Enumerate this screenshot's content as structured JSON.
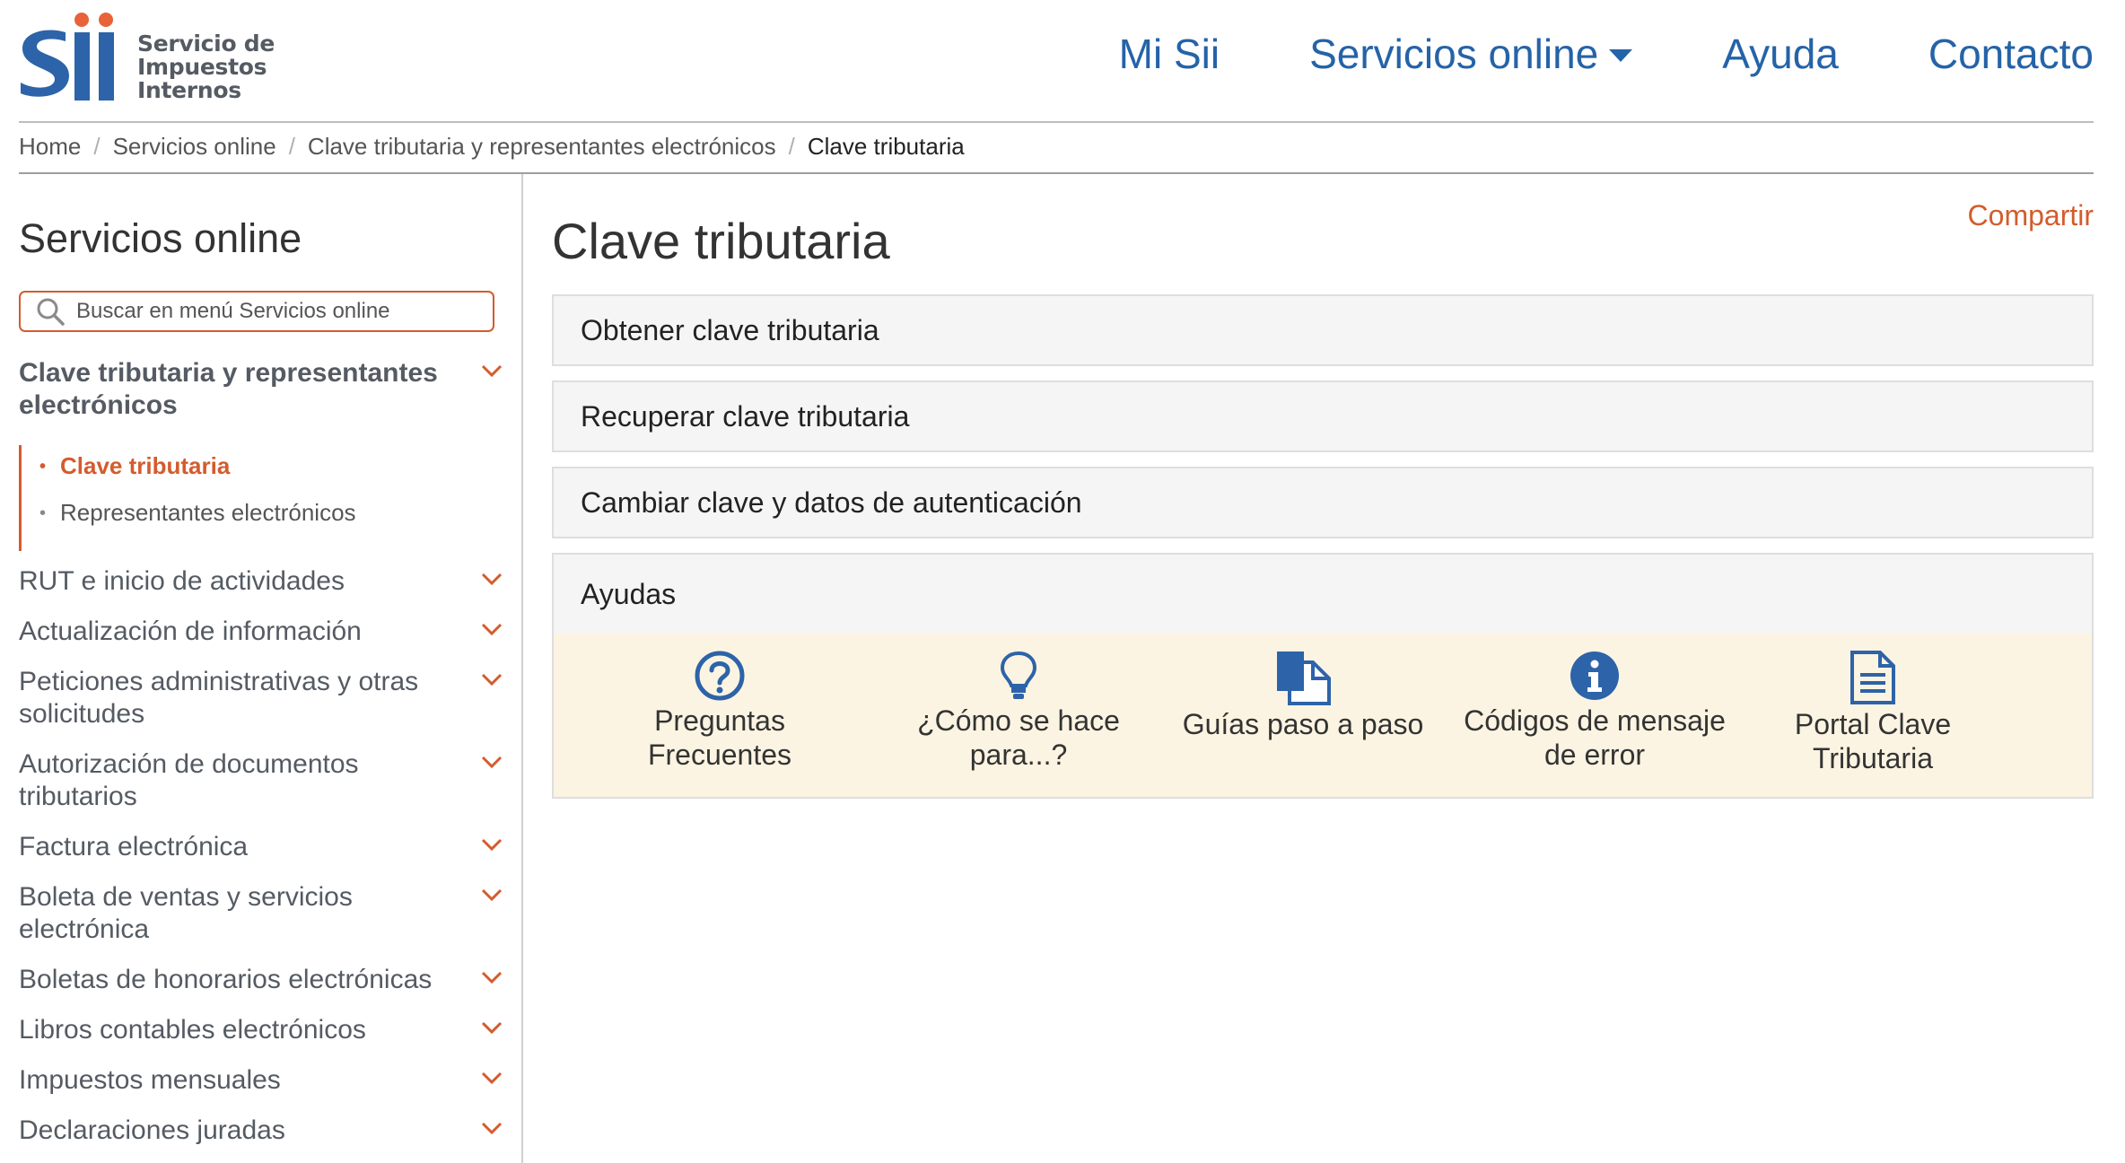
{
  "header": {
    "logo_text": [
      "Servicio de",
      "Impuestos",
      "Internos"
    ],
    "nav": [
      {
        "label": "Mi Sii",
        "has_caret": false
      },
      {
        "label": "Servicios online",
        "has_caret": true
      },
      {
        "label": "Ayuda",
        "has_caret": false
      },
      {
        "label": "Contacto",
        "has_caret": false
      }
    ]
  },
  "breadcrumb": [
    "Home",
    "Servicios online",
    "Clave tributaria y representantes electrónicos",
    "Clave tributaria"
  ],
  "sidebar": {
    "title": "Servicios online",
    "search_placeholder": "Buscar en menú Servicios online",
    "active_section": "Clave tributaria y representantes electrónicos",
    "subitems": [
      {
        "label": "Clave tributaria",
        "current": true
      },
      {
        "label": "Representantes electrónicos",
        "current": false
      }
    ],
    "sections": [
      "RUT e inicio de actividades",
      "Actualización de información",
      "Peticiones administrativas y otras solicitudes",
      "Autorización de documentos tributarios",
      "Factura electrónica",
      "Boleta de ventas y servicios electrónica",
      "Boletas de honorarios electrónicas",
      "Libros contables electrónicos",
      "Impuestos mensuales",
      "Declaraciones juradas"
    ]
  },
  "main": {
    "title": "Clave tributaria",
    "share_label": "Compartir",
    "accordions": [
      "Obtener clave tributaria",
      "Recuperar clave tributaria",
      "Cambiar clave y datos de autenticación",
      "Ayudas"
    ],
    "help_items": [
      {
        "icon": "question-circle-icon",
        "lines": [
          "Preguntas",
          "Frecuentes"
        ]
      },
      {
        "icon": "lightbulb-icon",
        "lines": [
          "¿Cómo se hace",
          "para...?"
        ]
      },
      {
        "icon": "documents-icon",
        "lines": [
          "Guías paso a paso"
        ]
      },
      {
        "icon": "info-circle-icon",
        "lines": [
          "Códigos de mensaje",
          "de error"
        ]
      },
      {
        "icon": "document-lines-icon",
        "lines": [
          "Portal Clave",
          "Tributaria"
        ]
      }
    ]
  },
  "colors": {
    "accent_orange": "#d35c2d",
    "nav_blue": "#2563a8",
    "icon_blue": "#2d63a8",
    "help_bg": "#fcf4e2",
    "accordion_bg": "#f5f5f5"
  }
}
